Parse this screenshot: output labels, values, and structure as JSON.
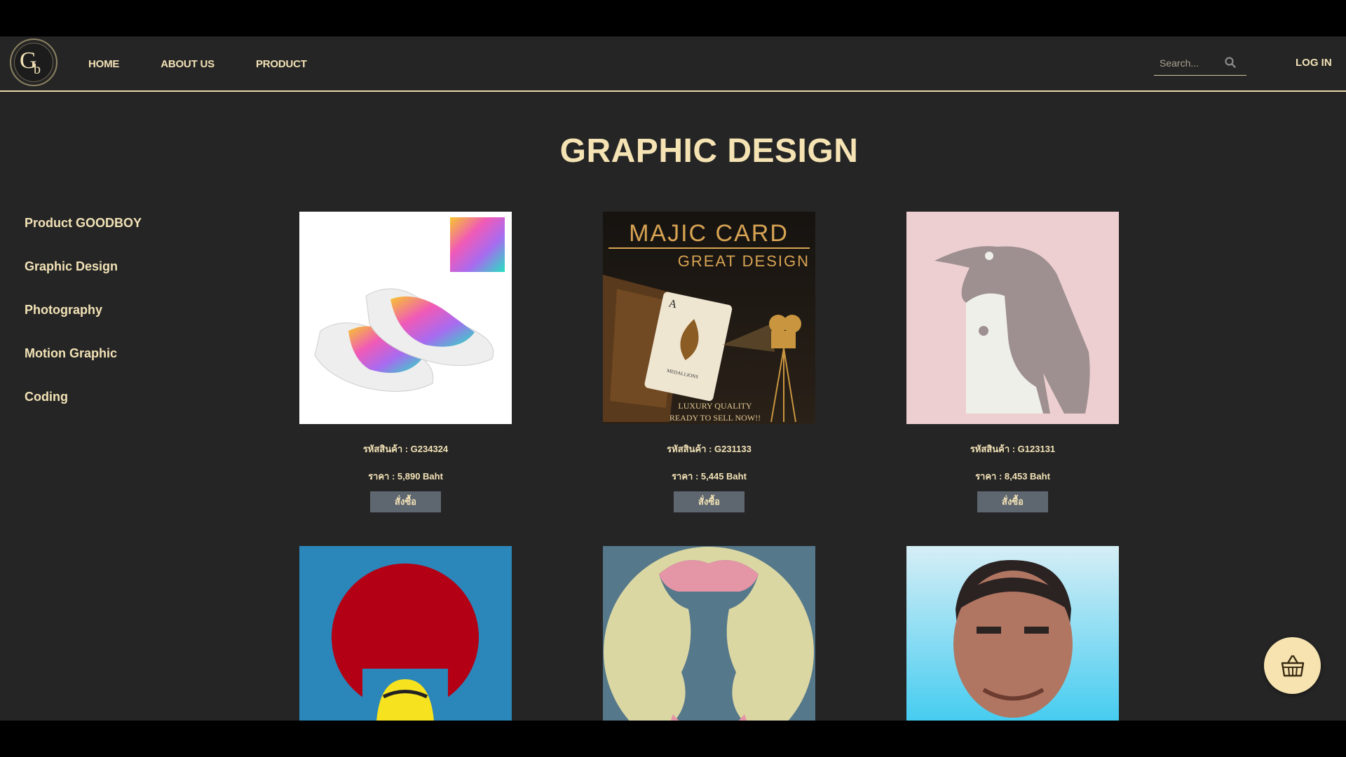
{
  "header": {
    "logo_text": "Gb",
    "nav": [
      {
        "label": "HOME"
      },
      {
        "label": "ABOUT US"
      },
      {
        "label": "PRODUCT"
      }
    ],
    "search_placeholder": "Search...",
    "login_label": "LOG IN"
  },
  "page_title": "GRAPHIC DESIGN",
  "sidebar": {
    "items": [
      {
        "label": "Product GOODBOY"
      },
      {
        "label": "Graphic Design"
      },
      {
        "label": "Photography"
      },
      {
        "label": "Motion Graphic"
      },
      {
        "label": "Coding"
      }
    ]
  },
  "products": [
    {
      "code": "รหัสสินค้า : G234324",
      "price": "ราคา : 5,890 Baht",
      "buy_label": "สั่งซื้อ",
      "image": "colorful-slip-on-shoes"
    },
    {
      "code": "รหัสสินค้า : G231133",
      "price": "ราคา : 5,445 Baht",
      "buy_label": "สั่งซื้อ",
      "image": "majic-card-poster"
    },
    {
      "code": "รหัสสินค้า : G123131",
      "price": "ราคา : 8,453 Baht",
      "buy_label": "สั่งซื้อ",
      "image": "penguin-illustration"
    },
    {
      "image": "afro-hair-illustration"
    },
    {
      "image": "apple-faces-illusion"
    },
    {
      "image": "man-portrait-pixel"
    }
  ],
  "poster": {
    "title": "MAJIC CARD",
    "subtitle": "GREAT DESIGN",
    "card_brand": "MEDALLIONS",
    "tagline_1": "LUXURY QUALITY",
    "tagline_2": "READY TO SELL NOW!!"
  },
  "colors": {
    "background": "#252525",
    "text": "#f2e2b6",
    "button": "#5e6670",
    "basket": "#f6e3b0"
  },
  "icons": {
    "search": "search-icon",
    "basket": "basket-icon"
  }
}
